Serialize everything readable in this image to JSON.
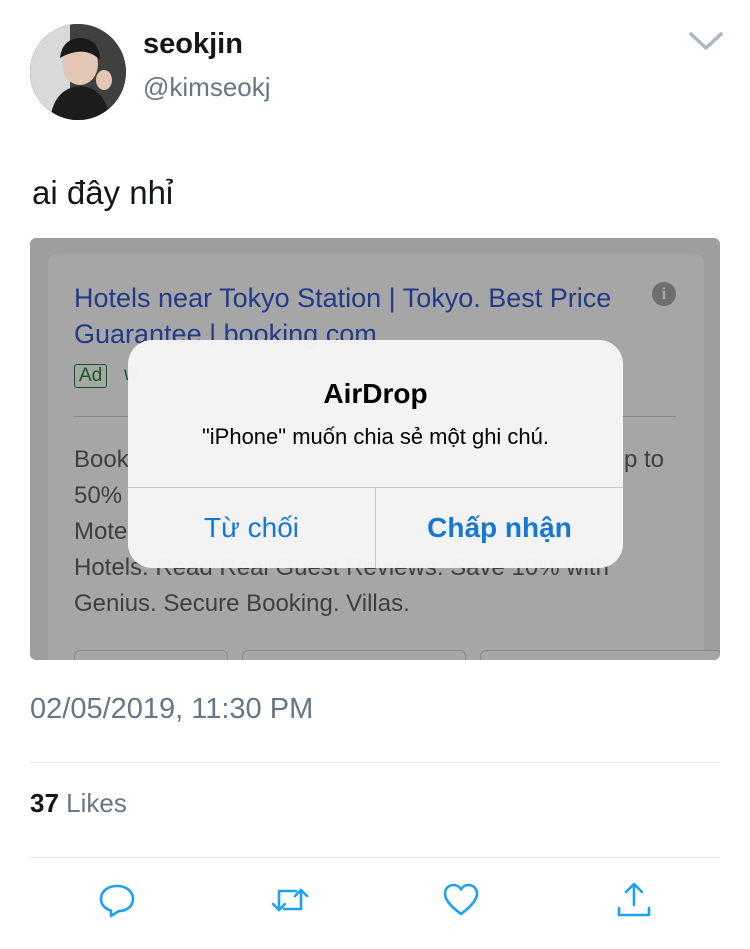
{
  "tweet": {
    "display_name": "seokjin",
    "handle": "@kimseokj",
    "text": "ai đây nhỉ",
    "timestamp": "02/05/2019, 11:30 PM",
    "likes_count": "37",
    "likes_label": "Likes"
  },
  "ad": {
    "title": "Hotels near Tokyo Station | Tokyo. Best Price Guarantee | booking.com",
    "badge": "Ad",
    "url_fragment": "w",
    "body_lines": [
      "Book",
      "50%",
      "Mote",
      "Hotels. Read Real Guest Reviews. Save 10% with",
      "Genius. Secure Booking. Villas."
    ],
    "body_right": "p to",
    "info_icon": "info-icon"
  },
  "alert": {
    "title": "AirDrop",
    "message": "\"iPhone\" muốn chia sẻ một ghi chú.",
    "decline_label": "Từ chối",
    "accept_label": "Chấp nhận"
  },
  "icons": {
    "caret": "chevron-down-icon",
    "reply": "reply-icon",
    "retweet": "retweet-icon",
    "like": "heart-icon",
    "share": "share-icon"
  },
  "colors": {
    "text": "#14171a",
    "secondary": "#657786",
    "icon": "#1da1f2",
    "ios_blue": "#1478d4"
  }
}
